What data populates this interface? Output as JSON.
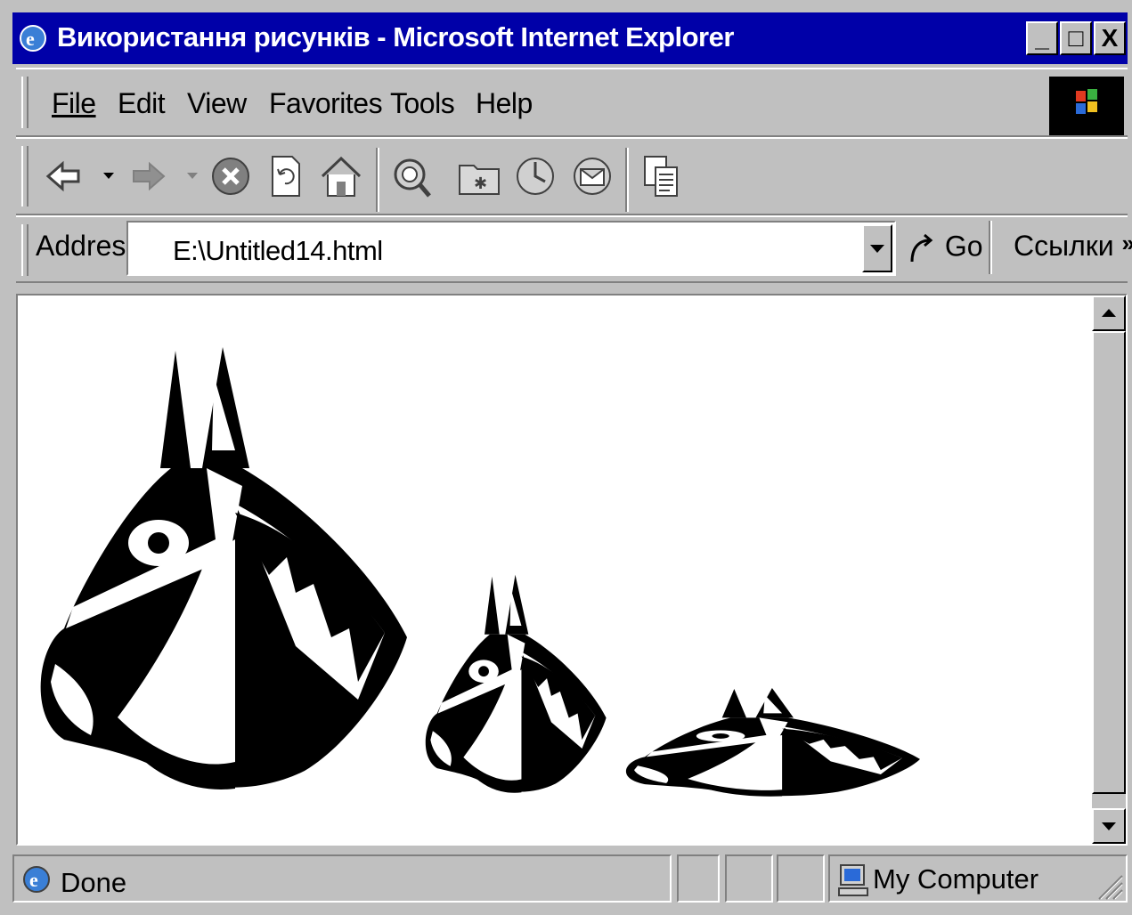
{
  "window": {
    "title": "Використання рисунків - Microsoft Internet Explorer",
    "minimize_label": "_",
    "maximize_label": "□",
    "close_label": "X"
  },
  "menu": {
    "items": [
      {
        "label": "File"
      },
      {
        "label": "Edit"
      },
      {
        "label": "View"
      },
      {
        "label": "Favorites"
      },
      {
        "label": "Tools"
      },
      {
        "label": "Help"
      }
    ]
  },
  "toolbar": {
    "icons": [
      "back-icon",
      "forward-icon",
      "stop-icon",
      "refresh-icon",
      "home-icon",
      "search-icon",
      "favorites-icon",
      "history-icon",
      "mail-icon",
      "copy-icon"
    ]
  },
  "address_bar": {
    "label": "Address",
    "value": "E:\\Untitled14.html",
    "go_label": "Go",
    "links_label": "Ссылки",
    "more_label": "»"
  },
  "content": {
    "images": [
      "horse-head-large",
      "horse-head-small",
      "horse-head-flattened"
    ]
  },
  "status_bar": {
    "status_text": "Done",
    "zone_text": "My Computer"
  },
  "colors": {
    "title_bar": "#0000a8",
    "chrome": "#c0c0c0",
    "content_bg": "#ffffff"
  }
}
